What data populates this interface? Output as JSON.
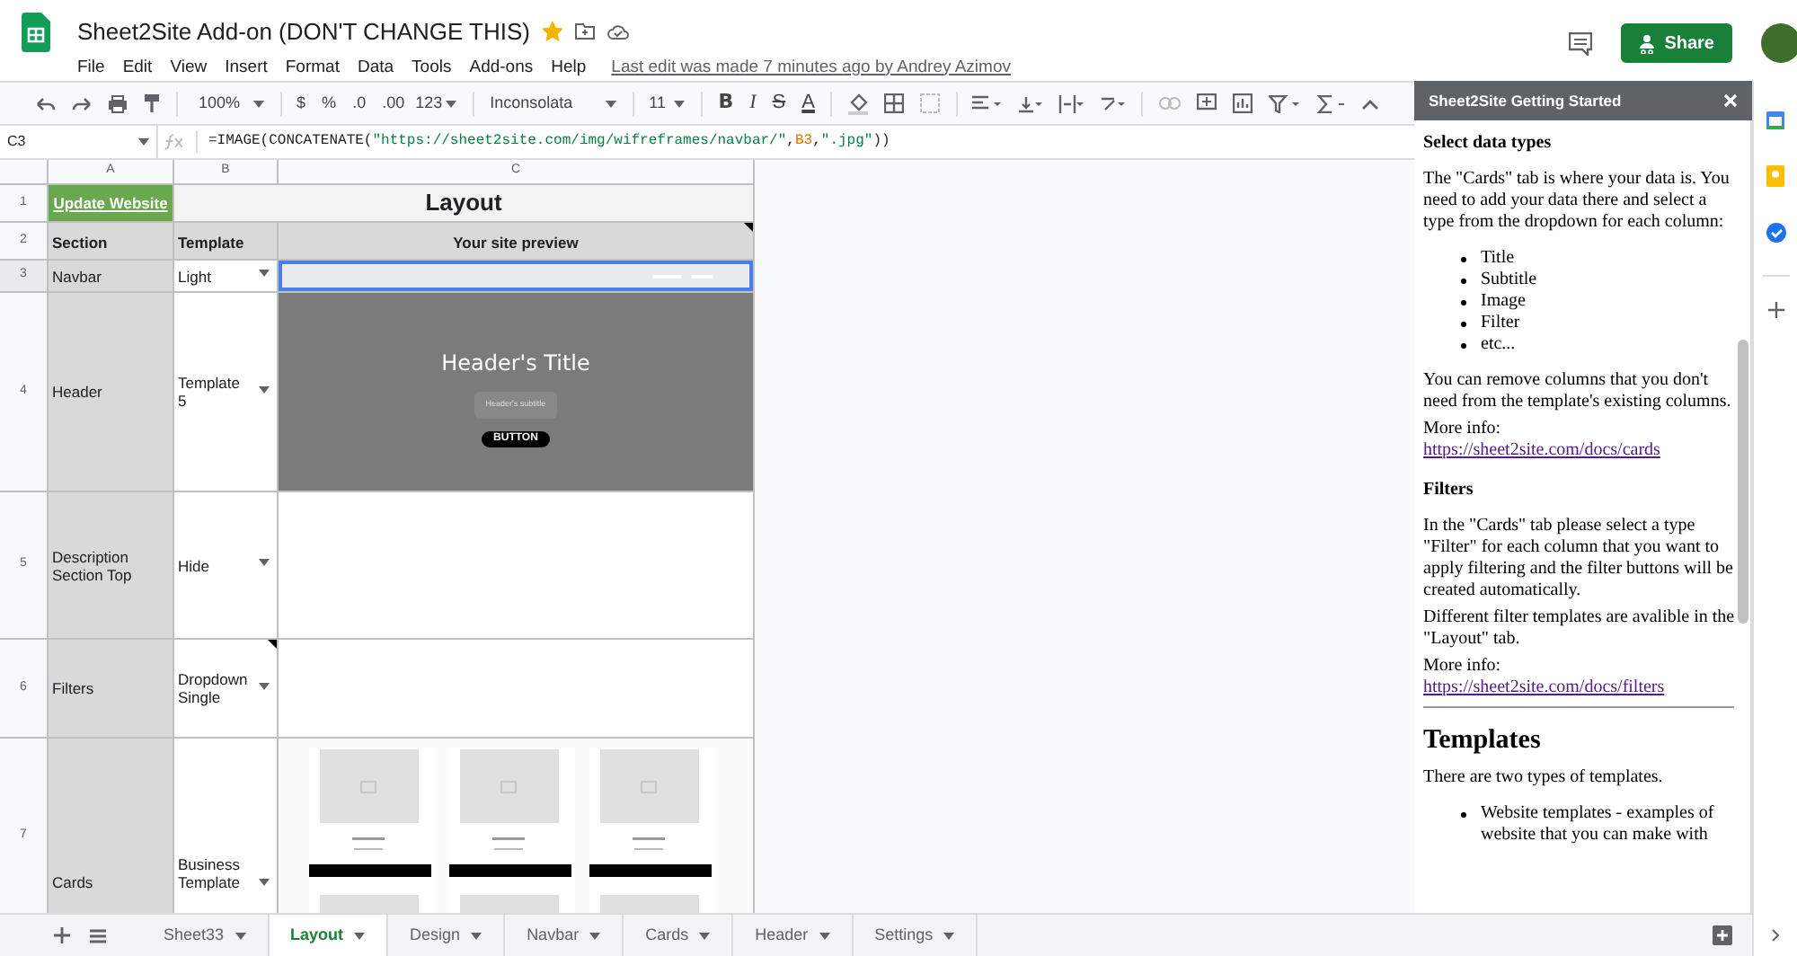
{
  "document": {
    "title": "Sheet2Site Add-on (DON'T CHANGE THIS)",
    "starred": true,
    "menus": [
      "File",
      "Edit",
      "View",
      "Insert",
      "Format",
      "Data",
      "Tools",
      "Add-ons",
      "Help"
    ],
    "last_edit": "Last edit was made 7 minutes ago by Andrey Azimov",
    "share": "Share"
  },
  "toolbar": {
    "zoom": "100%",
    "currency": "$",
    "percent": "%",
    "decrease_decimals": ".0",
    "increase_decimals": ".00",
    "more_formats": "123",
    "font": "Inconsolata",
    "font_size": "11",
    "bold": "B",
    "italic": "I",
    "strikethrough": "S",
    "text_color": "A"
  },
  "formula_bar": {
    "cell": "C3",
    "formula": [
      {
        "kind": "plain",
        "text": "=IMAGE(CONCATENATE("
      },
      {
        "kind": "string",
        "text": "\"https://sheet2site.com/img/wifreframes/navbar/\""
      },
      {
        "kind": "plain",
        "text": ","
      },
      {
        "kind": "ref",
        "text": "B3"
      },
      {
        "kind": "plain",
        "text": ","
      },
      {
        "kind": "string",
        "text": "\".jpg\""
      },
      {
        "kind": "plain",
        "text": "))"
      }
    ]
  },
  "sheet": {
    "columns": [
      "A",
      "B",
      "C"
    ],
    "title_row": {
      "number": "1",
      "button": "Update Website",
      "title": "Layout"
    },
    "header_row": {
      "number": "2",
      "section": "Section",
      "template": "Template",
      "preview": "Your site preview",
      "preview_note": true
    },
    "rows": [
      {
        "number": "3",
        "section": "Navbar",
        "template": "Light",
        "note": false,
        "selected": true,
        "preview": {
          "kind": "navbar"
        }
      },
      {
        "number": "4",
        "section": "Header",
        "template": "Template 5",
        "note": false,
        "selected": false,
        "preview": {
          "kind": "header",
          "title": "Header's Title",
          "subtitle": "Header's subtitle",
          "button": "BUTTON"
        }
      },
      {
        "number": "5",
        "section": "Description Section Top",
        "template": "Hide",
        "note": false,
        "selected": false
      },
      {
        "number": "6",
        "section": "Filters",
        "template": "Dropdown Single",
        "note": true,
        "selected": false
      },
      {
        "number": "7",
        "section": "Cards",
        "template": "Business Template",
        "note": false,
        "selected": false,
        "preview": {
          "kind": "cards"
        }
      }
    ]
  },
  "sidebar": {
    "title": "Sheet2Site Getting Started",
    "blocks": [
      {
        "kind": "heading",
        "text": "Select data types"
      },
      {
        "kind": "paragraph",
        "text": "The \"Cards\" tab is where your data is. You need to add your data there and select a type from the dropdown for each column:"
      },
      {
        "kind": "list",
        "items": [
          "Title",
          "Subtitle",
          "Image",
          "Filter",
          "etc..."
        ]
      },
      {
        "kind": "paragraph",
        "text": "You can remove columns that you don't need from the template's existing columns."
      },
      {
        "kind": "more",
        "text": "More info:",
        "link": "https://sheet2site.com/docs/cards"
      },
      {
        "kind": "heading",
        "text": "Filters"
      },
      {
        "kind": "paragraph",
        "text": "In the \"Cards\" tab please select a type \"Filter\" for each column that you want to apply filtering and the filter buttons will be created automatically."
      },
      {
        "kind": "paragraph",
        "text": "Different filter templates are avalible in the \"Layout\" tab."
      },
      {
        "kind": "more",
        "text": "More info:",
        "link": "https://sheet2site.com/docs/filters"
      },
      {
        "kind": "rule"
      },
      {
        "kind": "title",
        "text": "Templates"
      },
      {
        "kind": "paragraph",
        "text": "There are two types of templates."
      },
      {
        "kind": "list",
        "items": [
          "Website templates - examples of website that you can make with"
        ]
      }
    ]
  },
  "sheet_tabs": [
    {
      "label": "Sheet33",
      "selected": false
    },
    {
      "label": "Layout",
      "selected": true
    },
    {
      "label": "Design",
      "selected": false
    },
    {
      "label": "Navbar",
      "selected": false
    },
    {
      "label": "Cards",
      "selected": false
    },
    {
      "label": "Header",
      "selected": false
    },
    {
      "label": "Settings",
      "selected": false
    }
  ]
}
